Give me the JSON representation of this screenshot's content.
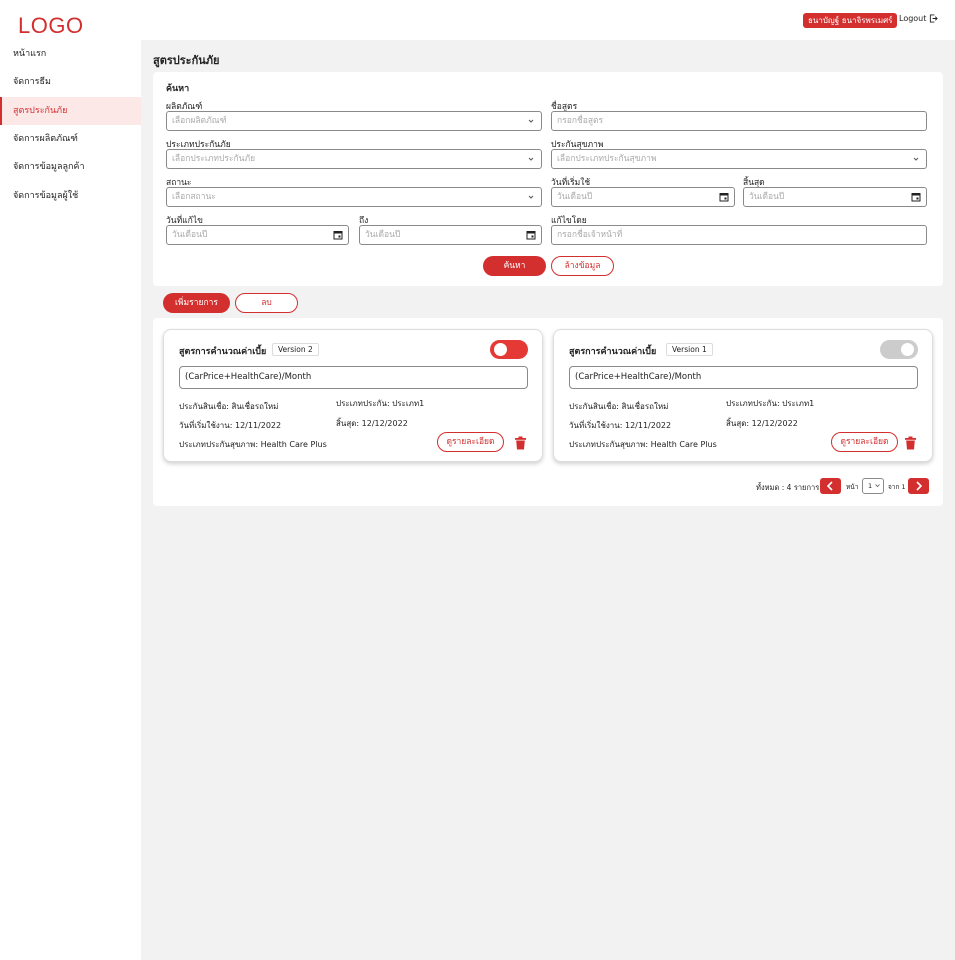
{
  "header": {
    "logo": "LOGO",
    "user_name": "ธนาบัญฐ์ ธนาจิรพรเมศร์",
    "logout_label": "Logout"
  },
  "sidebar": {
    "items": [
      {
        "label": "หน้าแรก"
      },
      {
        "label": "จัดการธีม"
      },
      {
        "label": "สูตรประกันภัย",
        "active": true
      },
      {
        "label": "จัดการผลิตภัณฑ์"
      },
      {
        "label": "จัดการข้อมูลลูกค้า"
      },
      {
        "label": "จัดการข้อมูลผู้ใช้"
      }
    ]
  },
  "page_title": "สูตรประกันภัย",
  "search": {
    "heading": "ค้นหา",
    "product_label": "ผลิตภัณฑ์",
    "product_placeholder": "เลือกผลิตภัณฑ์",
    "formula_name_label": "ชื่อสูตร",
    "formula_name_placeholder": "กรอกชื่อสูตร",
    "insurance_type_label": "ประเภทประกันภัย",
    "insurance_type_placeholder": "เลือกประเภทประกันภัย",
    "health_label": "ประกันสุขภาพ",
    "health_placeholder": "เลือกประเภทประกันสุขภาพ",
    "status_label": "สถานะ",
    "status_placeholder": "เลือกสถานะ",
    "start_label": "วันที่เริ่มใช้",
    "start_placeholder": "วันเดือนปี",
    "end_label": "สิ้นสุด",
    "end_placeholder": "วันเดือนปี",
    "edit_date_label": "วันที่แก้ไข",
    "edit_date_placeholder": "วันเดือนปี",
    "to_label": "ถึง",
    "to_placeholder": "วันเดือนปี",
    "edited_by_label": "แก้ไขโดย",
    "edited_by_placeholder": "กรอกชื่อเจ้าหน้าที่",
    "search_button": "ค้นหา",
    "clear_button": "ล้างข้อมูล"
  },
  "actions": {
    "add_button": "เพิ่มรายการ",
    "delete_button": "ลบ"
  },
  "cards": [
    {
      "title": "สูตรการคำนวณค่าเบี้ย",
      "version": "Version 2",
      "enabled": true,
      "formula": "(CarPrice+HealthCare)/Month",
      "loan_insurance": "ประกันสินเชื่อ: สินเชื่อรถใหม่",
      "insurance_type": "ประเภทประกัน: ประเภท1",
      "start_date": "วันที่เริ่มใช้งาน: 12/11/2022",
      "end_date": "สิ้นสุด: 12/12/2022",
      "health_type": "ประเภทประกันสุขภาพ: Health Care Plus",
      "detail_button": "ดูรายละเอียด"
    },
    {
      "title": "สูตรการคำนวณค่าเบี้ย",
      "version": "Version 1",
      "enabled": false,
      "formula": "(CarPrice+HealthCare)/Month",
      "loan_insurance": "ประกันสินเชื่อ: สินเชื่อรถใหม่",
      "insurance_type": "ประเภทประกัน: ประเภท1",
      "start_date": "วันที่เริ่มใช้งาน: 12/11/2022",
      "end_date": "สิ้นสุด: 12/12/2022",
      "health_type": "ประเภทประกันสุขภาพ: Health Care Plus",
      "detail_button": "ดูรายละเอียด"
    }
  ],
  "pagination": {
    "total": "ทั้งหมด : 4 รายการ",
    "page_label": "หน้า",
    "current_page": "1",
    "of_label": "จาก 1"
  },
  "colors": {
    "accent": "#d32f2f",
    "active_bg": "#fde8e8",
    "page_bg": "#f2f2f2"
  }
}
